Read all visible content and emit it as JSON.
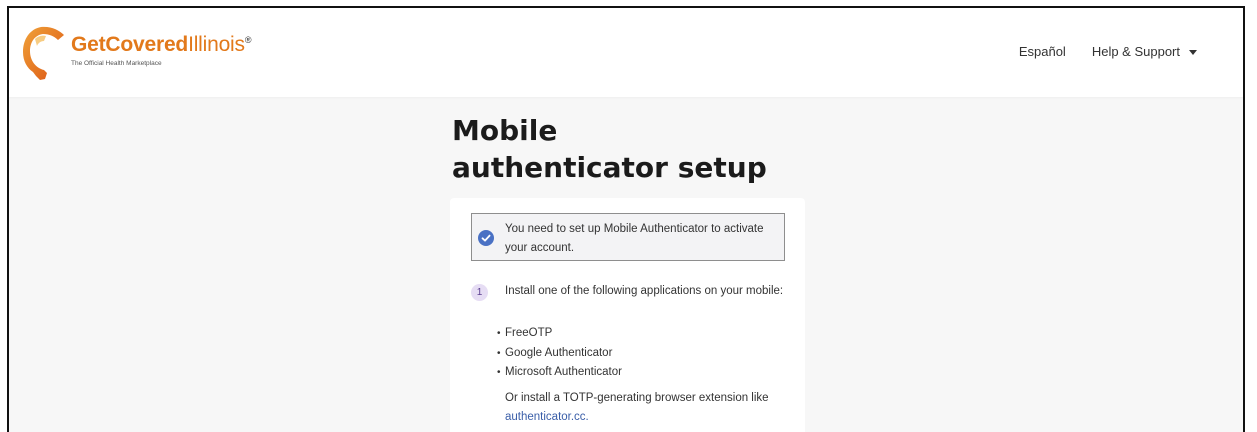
{
  "header": {
    "logo": {
      "word_get": "Get",
      "word_covered": "Covered",
      "word_illinois": "Illinois",
      "registered": "®",
      "tagline": "The Official Health Marketplace"
    },
    "nav": {
      "language": "Español",
      "help": "Help & Support"
    }
  },
  "main": {
    "title": "Mobile authenticator setup",
    "alert": {
      "icon": "check-circle-icon",
      "text": "You need to set up Mobile Authenticator to activate your account."
    },
    "step1": {
      "number": "1",
      "text": "Install one of the following applications on your mobile:",
      "apps": [
        "FreeOTP",
        "Google Authenticator",
        "Microsoft Authenticator"
      ],
      "note_prefix": "Or install a TOTP-generating browser extension like",
      "note_link": "authenticator.cc."
    }
  },
  "colors": {
    "brand_orange": "#e2791b",
    "alert_icon_blue": "#4a71c4",
    "link_blue": "#3a5ea8",
    "step_badge_bg": "#e6ddf4"
  }
}
